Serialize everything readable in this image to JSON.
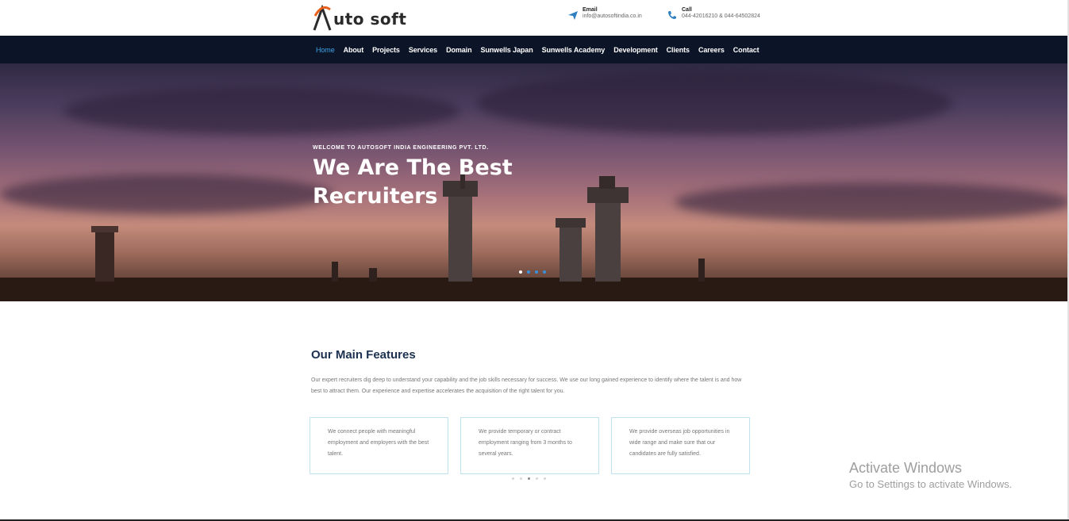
{
  "header": {
    "logo_text": "uto soft",
    "email": {
      "label": "Email",
      "value": "info@autosoftindia.co.in",
      "icon": "paper-plane-icon"
    },
    "call": {
      "label": "Call",
      "value": "044-42016210 & 044-64502824",
      "icon": "phone-icon"
    }
  },
  "nav": {
    "items": [
      "Home",
      "About",
      "Projects",
      "Services",
      "Domain",
      "Sunwells Japan",
      "Sunwells Academy",
      "Development",
      "Clients",
      "Careers",
      "Contact"
    ],
    "active": "Home"
  },
  "hero": {
    "subtitle": "WELCOME TO AUTOSOFT INDIA ENGINEERING PVT. LTD.",
    "title": "We Are The Best Recruiters",
    "slide_count": 4,
    "active_slide": 1
  },
  "features": {
    "title": "Our Main Features",
    "text": "Our expert recruiters dig deep to understand your capability and the job skills necessary for success. We use our long gained experience to identify where the talent is and how best to attract them. Our experience and expertise accelerates the acquisition of the right talent for you.",
    "cards": [
      "We connect people with meaningful employment and employers with the best talent.",
      "We provide temporary or contract employment ranging from 3 months to several years.",
      "We provide overseas job opportunities in wide range and make sure that our candidates are fully satisfied."
    ],
    "carousel_dots": 5,
    "active_dot": 3
  },
  "watermark": {
    "title": "Activate Windows",
    "subtitle": "Go to Settings to activate Windows."
  },
  "colors": {
    "nav_bg": "#0c1427",
    "accent": "#3da4e6",
    "heading": "#1c3050",
    "logo_orange": "#e8601c"
  }
}
